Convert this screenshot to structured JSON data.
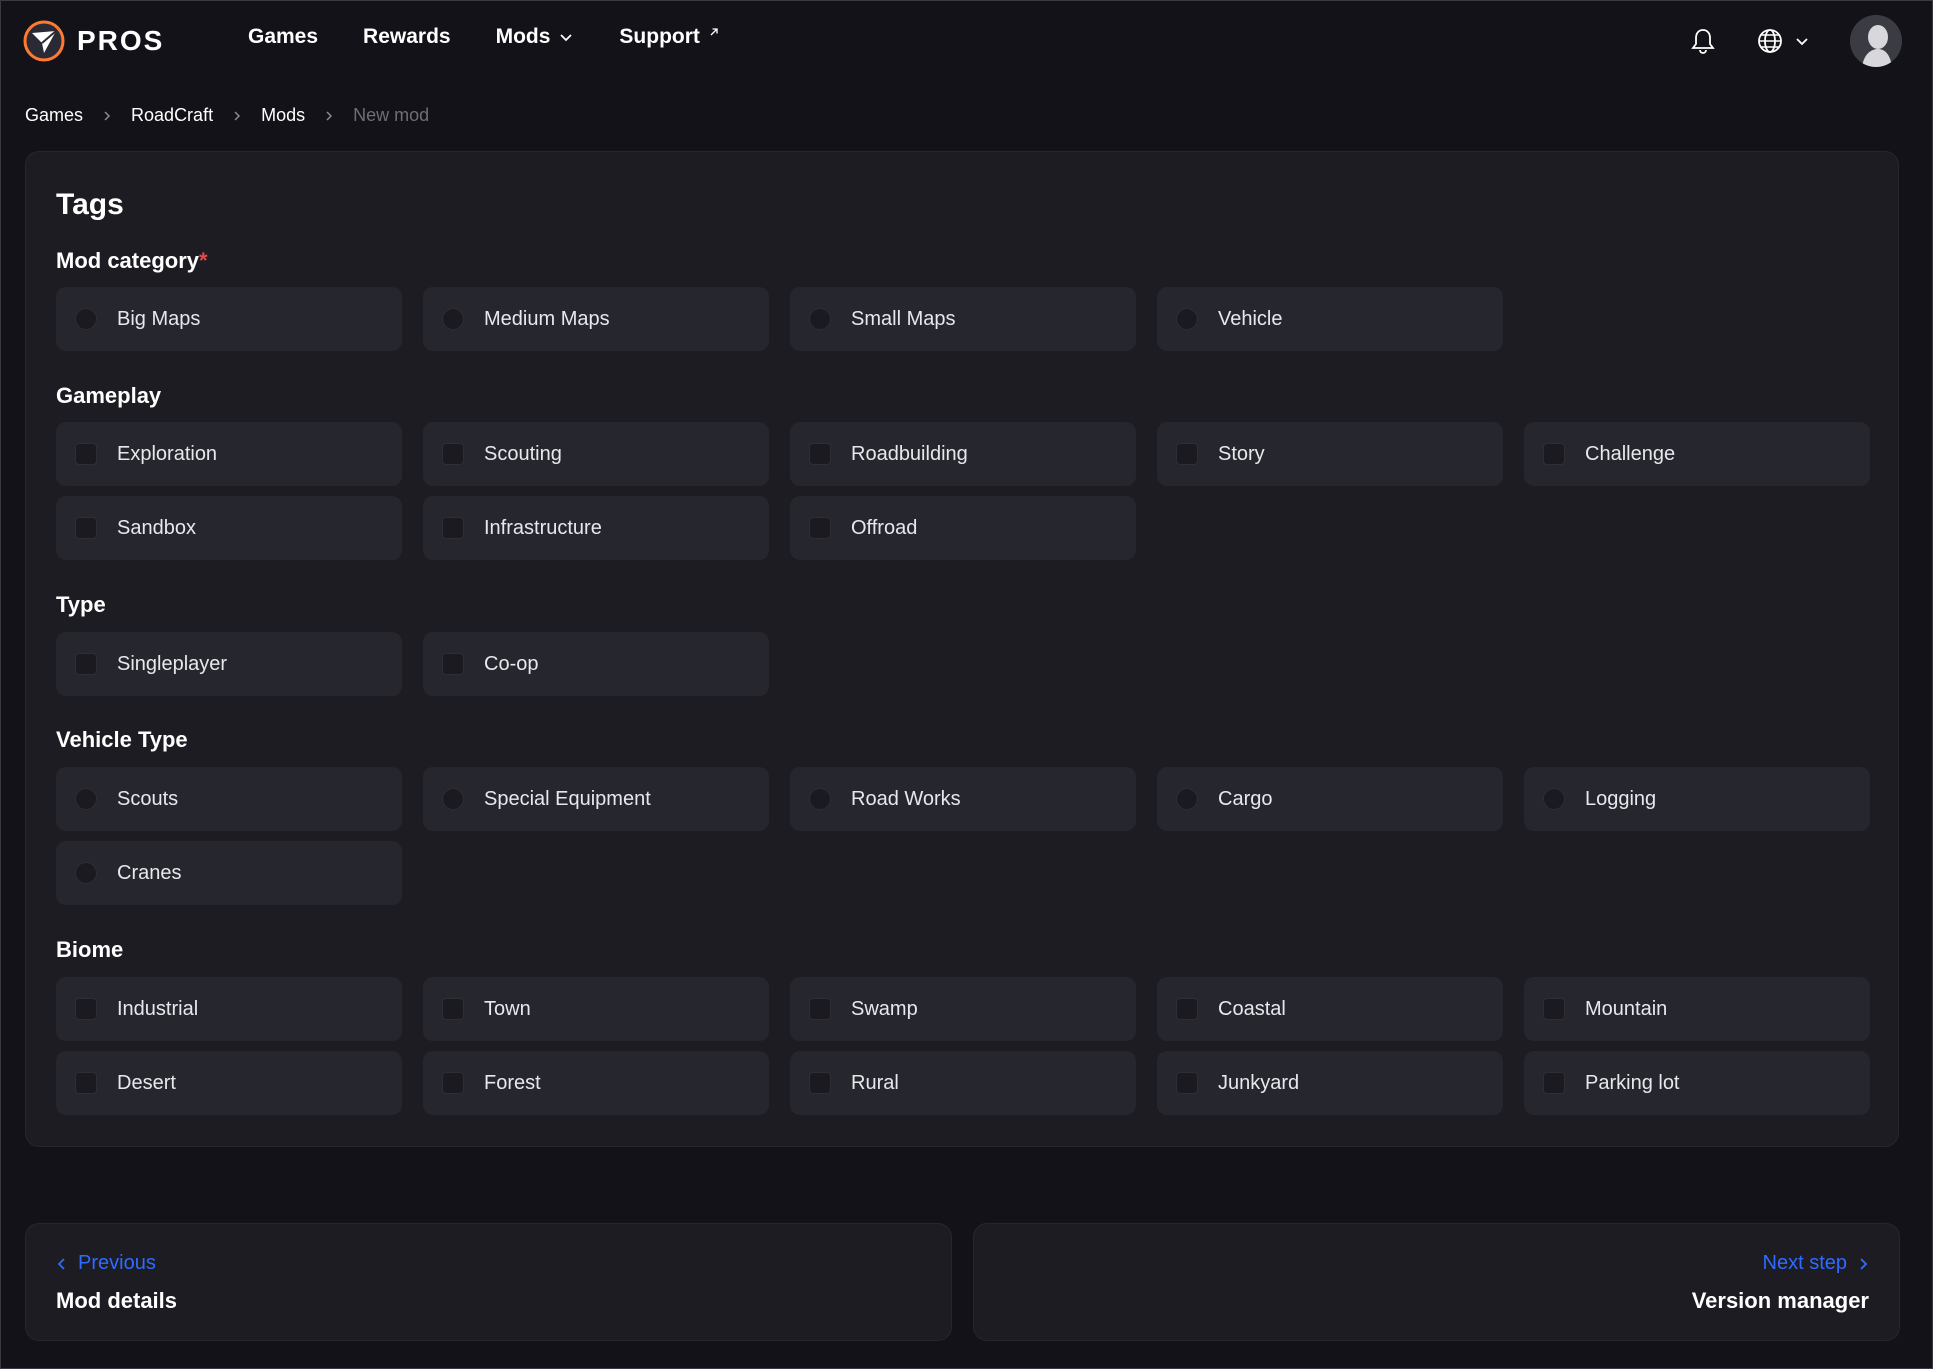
{
  "header": {
    "brand": "PROS",
    "nav": [
      {
        "label": "Games"
      },
      {
        "label": "Rewards"
      },
      {
        "label": "Mods",
        "icon": "chevron-down-icon"
      },
      {
        "label": "Support",
        "icon": "external-link-icon"
      }
    ]
  },
  "breadcrumb": [
    "Games",
    "RoadCraft",
    "Mods",
    "New mod"
  ],
  "card": {
    "title": "Tags",
    "sections": [
      {
        "label": "Mod category",
        "required_mark": "*",
        "control": "radio",
        "options": [
          "Big Maps",
          "Medium Maps",
          "Small Maps",
          "Vehicle"
        ]
      },
      {
        "label": "Gameplay",
        "control": "checkbox",
        "options": [
          "Exploration",
          "Scouting",
          "Roadbuilding",
          "Story",
          "Challenge",
          "Sandbox",
          "Infrastructure",
          "Offroad"
        ]
      },
      {
        "label": "Type",
        "control": "checkbox",
        "options": [
          "Singleplayer",
          "Co-op"
        ]
      },
      {
        "label": "Vehicle Type",
        "control": "radio",
        "options": [
          "Scouts",
          "Special Equipment",
          "Road Works",
          "Cargo",
          "Logging",
          "Cranes"
        ]
      },
      {
        "label": "Biome",
        "control": "checkbox",
        "options": [
          "Industrial",
          "Town",
          "Swamp",
          "Coastal",
          "Mountain",
          "Desert",
          "Forest",
          "Rural",
          "Junkyard",
          "Parking lot"
        ]
      }
    ]
  },
  "footer": {
    "prev": {
      "link": "Previous",
      "title": "Mod details"
    },
    "next": {
      "link": "Next step",
      "title": "Version manager"
    }
  },
  "colors": {
    "accent": "#2f6bff",
    "required": "#e5484d",
    "background": "#121218",
    "card": "#1c1c22",
    "option": "#26262e"
  }
}
